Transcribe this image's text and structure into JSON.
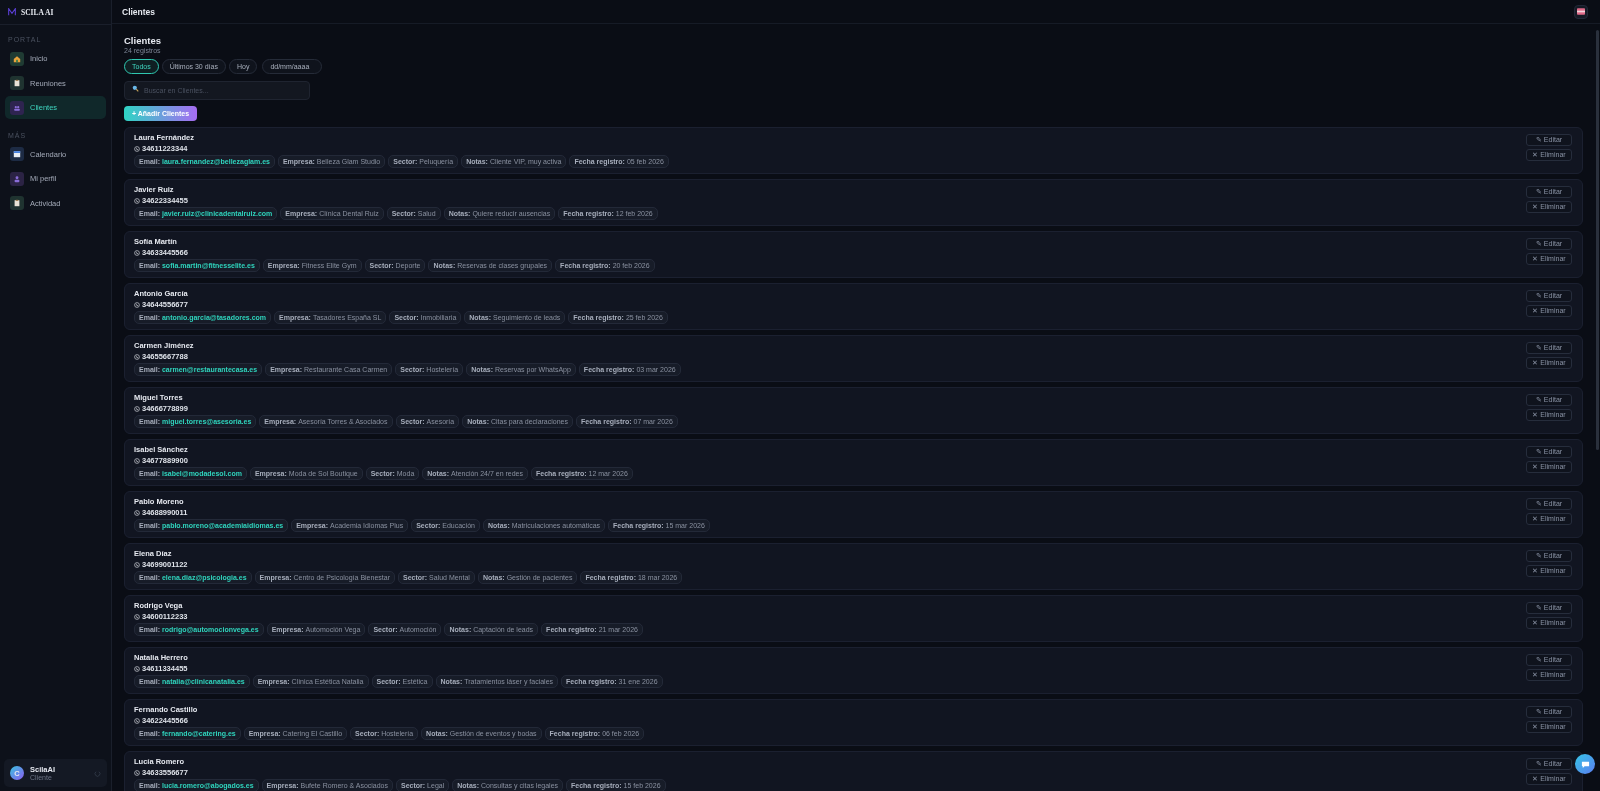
{
  "sidebar": {
    "brand": "SCILA AI",
    "sections": [
      {
        "title": "PORTAL",
        "items": [
          {
            "label": "Inicio",
            "selected": false
          },
          {
            "label": "Reuniones",
            "selected": false
          },
          {
            "label": "Clientes",
            "selected": true
          }
        ]
      },
      {
        "title": "MÁS",
        "items": [
          {
            "label": "Calendario",
            "selected": false
          },
          {
            "label": "Mi perfil",
            "selected": false
          },
          {
            "label": "Actividad",
            "selected": false
          }
        ]
      }
    ],
    "user": {
      "avatar": "C",
      "name": "ScilaAI",
      "role": "Cliente"
    }
  },
  "header": {
    "title": "Clientes"
  },
  "page": {
    "title": "Clientes",
    "count": "24 registros",
    "filters": [
      {
        "label": "Todos",
        "selected": true
      },
      {
        "label": "Últimos 30 días",
        "selected": false
      },
      {
        "label": "Hoy",
        "selected": false
      }
    ],
    "date_field": {
      "placeholder": "dd/mm/aaaa"
    },
    "search": {
      "placeholder": "Buscar en Clientes..."
    },
    "add_button": "+ Añadir Clientes"
  },
  "clients": [
    {
      "name": "Laura Fernández",
      "phone": "34611223344",
      "edit": "✎ Editar",
      "delete": "✕ Eliminar",
      "fields": [
        {
          "label": "Email:",
          "value": "laura.fernandez@bellezaglam.es",
          "kind": "email"
        },
        {
          "label": "Empresa:",
          "value": "Belleza Glam Studio",
          "kind": "text"
        },
        {
          "label": "Sector:",
          "value": "Peluquería",
          "kind": "text"
        },
        {
          "label": "Notas:",
          "value": "Cliente VIP, muy activa",
          "kind": "text"
        },
        {
          "label": "Fecha registro:",
          "value": "05 feb 2026",
          "kind": "text"
        }
      ]
    },
    {
      "name": "Javier Ruiz",
      "phone": "34622334455",
      "edit": "✎ Editar",
      "delete": "✕ Eliminar",
      "fields": [
        {
          "label": "Email:",
          "value": "javier.ruiz@clinicadentalruiz.com",
          "kind": "email"
        },
        {
          "label": "Empresa:",
          "value": "Clínica Dental Ruiz",
          "kind": "text"
        },
        {
          "label": "Sector:",
          "value": "Salud",
          "kind": "text"
        },
        {
          "label": "Notas:",
          "value": "Quiere reducir ausencias",
          "kind": "text"
        },
        {
          "label": "Fecha registro:",
          "value": "12 feb 2026",
          "kind": "text"
        }
      ]
    },
    {
      "name": "Sofía Martín",
      "phone": "34633445566",
      "edit": "✎ Editar",
      "delete": "✕ Eliminar",
      "fields": [
        {
          "label": "Email:",
          "value": "sofia.martin@fitnesselite.es",
          "kind": "email"
        },
        {
          "label": "Empresa:",
          "value": "Fitness Elite Gym",
          "kind": "text"
        },
        {
          "label": "Sector:",
          "value": "Deporte",
          "kind": "text"
        },
        {
          "label": "Notas:",
          "value": "Reservas de clases grupales",
          "kind": "text"
        },
        {
          "label": "Fecha registro:",
          "value": "20 feb 2026",
          "kind": "text"
        }
      ]
    },
    {
      "name": "Antonio García",
      "phone": "34644556677",
      "edit": "✎ Editar",
      "delete": "✕ Eliminar",
      "fields": [
        {
          "label": "Email:",
          "value": "antonio.garcia@tasadores.com",
          "kind": "email"
        },
        {
          "label": "Empresa:",
          "value": "Tasadores España SL",
          "kind": "text"
        },
        {
          "label": "Sector:",
          "value": "Inmobiliaria",
          "kind": "text"
        },
        {
          "label": "Notas:",
          "value": "Seguimiento de leads",
          "kind": "text"
        },
        {
          "label": "Fecha registro:",
          "value": "25 feb 2026",
          "kind": "text"
        }
      ]
    },
    {
      "name": "Carmen Jiménez",
      "phone": "34655667788",
      "edit": "✎ Editar",
      "delete": "✕ Eliminar",
      "fields": [
        {
          "label": "Email:",
          "value": "carmen@restaurantecasa.es",
          "kind": "email"
        },
        {
          "label": "Empresa:",
          "value": "Restaurante Casa Carmen",
          "kind": "text"
        },
        {
          "label": "Sector:",
          "value": "Hostelería",
          "kind": "text"
        },
        {
          "label": "Notas:",
          "value": "Reservas por WhatsApp",
          "kind": "text"
        },
        {
          "label": "Fecha registro:",
          "value": "03 mar 2026",
          "kind": "text"
        }
      ]
    },
    {
      "name": "Miguel Torres",
      "phone": "34666778899",
      "edit": "✎ Editar",
      "delete": "✕ Eliminar",
      "fields": [
        {
          "label": "Email:",
          "value": "miguel.torres@asesoria.es",
          "kind": "email"
        },
        {
          "label": "Empresa:",
          "value": "Asesoría Torres & Asociados",
          "kind": "text"
        },
        {
          "label": "Sector:",
          "value": "Asesoría",
          "kind": "text"
        },
        {
          "label": "Notas:",
          "value": "Citas para declaraciones",
          "kind": "text"
        },
        {
          "label": "Fecha registro:",
          "value": "07 mar 2026",
          "kind": "text"
        }
      ]
    },
    {
      "name": "Isabel Sánchez",
      "phone": "34677889900",
      "edit": "✎ Editar",
      "delete": "✕ Eliminar",
      "fields": [
        {
          "label": "Email:",
          "value": "isabel@modadesol.com",
          "kind": "email"
        },
        {
          "label": "Empresa:",
          "value": "Moda de Sol Boutique",
          "kind": "text"
        },
        {
          "label": "Sector:",
          "value": "Moda",
          "kind": "text"
        },
        {
          "label": "Notas:",
          "value": "Atención 24/7 en redes",
          "kind": "text"
        },
        {
          "label": "Fecha registro:",
          "value": "12 mar 2026",
          "kind": "text"
        }
      ]
    },
    {
      "name": "Pablo Moreno",
      "phone": "34688990011",
      "edit": "✎ Editar",
      "delete": "✕ Eliminar",
      "fields": [
        {
          "label": "Email:",
          "value": "pablo.moreno@academiaidiomas.es",
          "kind": "email"
        },
        {
          "label": "Empresa:",
          "value": "Academia Idiomas Plus",
          "kind": "text"
        },
        {
          "label": "Sector:",
          "value": "Educación",
          "kind": "text"
        },
        {
          "label": "Notas:",
          "value": "Matriculaciones automáticas",
          "kind": "text"
        },
        {
          "label": "Fecha registro:",
          "value": "15 mar 2026",
          "kind": "text"
        }
      ]
    },
    {
      "name": "Elena Díaz",
      "phone": "34699001122",
      "edit": "✎ Editar",
      "delete": "✕ Eliminar",
      "fields": [
        {
          "label": "Email:",
          "value": "elena.diaz@psicologia.es",
          "kind": "email"
        },
        {
          "label": "Empresa:",
          "value": "Centro de Psicología Bienestar",
          "kind": "text"
        },
        {
          "label": "Sector:",
          "value": "Salud Mental",
          "kind": "text"
        },
        {
          "label": "Notas:",
          "value": "Gestión de pacientes",
          "kind": "text"
        },
        {
          "label": "Fecha registro:",
          "value": "18 mar 2026",
          "kind": "text"
        }
      ]
    },
    {
      "name": "Rodrigo Vega",
      "phone": "34600112233",
      "edit": "✎ Editar",
      "delete": "✕ Eliminar",
      "fields": [
        {
          "label": "Email:",
          "value": "rodrigo@automocionvega.es",
          "kind": "email"
        },
        {
          "label": "Empresa:",
          "value": "Automoción Vega",
          "kind": "text"
        },
        {
          "label": "Sector:",
          "value": "Automoción",
          "kind": "text"
        },
        {
          "label": "Notas:",
          "value": "Captación de leads",
          "kind": "text"
        },
        {
          "label": "Fecha registro:",
          "value": "21 mar 2026",
          "kind": "text"
        }
      ]
    },
    {
      "name": "Natalia Herrero",
      "phone": "34611334455",
      "edit": "✎ Editar",
      "delete": "✕ Eliminar",
      "fields": [
        {
          "label": "Email:",
          "value": "natalia@clinicanatalia.es",
          "kind": "email"
        },
        {
          "label": "Empresa:",
          "value": "Clínica Estética Natalia",
          "kind": "text"
        },
        {
          "label": "Sector:",
          "value": "Estética",
          "kind": "text"
        },
        {
          "label": "Notas:",
          "value": "Tratamientos láser y faciales",
          "kind": "text"
        },
        {
          "label": "Fecha registro:",
          "value": "31 ene 2026",
          "kind": "text"
        }
      ]
    },
    {
      "name": "Fernando Castillo",
      "phone": "34622445566",
      "edit": "✎ Editar",
      "delete": "✕ Eliminar",
      "fields": [
        {
          "label": "Email:",
          "value": "fernando@catering.es",
          "kind": "email"
        },
        {
          "label": "Empresa:",
          "value": "Catering El Castillo",
          "kind": "text"
        },
        {
          "label": "Sector:",
          "value": "Hostelería",
          "kind": "text"
        },
        {
          "label": "Notas:",
          "value": "Gestión de eventos y bodas",
          "kind": "text"
        },
        {
          "label": "Fecha registro:",
          "value": "06 feb 2026",
          "kind": "text"
        }
      ]
    },
    {
      "name": "Lucía Romero",
      "phone": "34633556677",
      "edit": "✎ Editar",
      "delete": "✕ Eliminar",
      "fields": [
        {
          "label": "Email:",
          "value": "lucia.romero@abogados.es",
          "kind": "email"
        },
        {
          "label": "Empresa:",
          "value": "Bufete Romero & Asociados",
          "kind": "text"
        },
        {
          "label": "Sector:",
          "value": "Legal",
          "kind": "text"
        },
        {
          "label": "Notas:",
          "value": "Consultas y citas legales",
          "kind": "text"
        },
        {
          "label": "Fecha registro:",
          "value": "15 feb 2026",
          "kind": "text"
        }
      ]
    }
  ]
}
